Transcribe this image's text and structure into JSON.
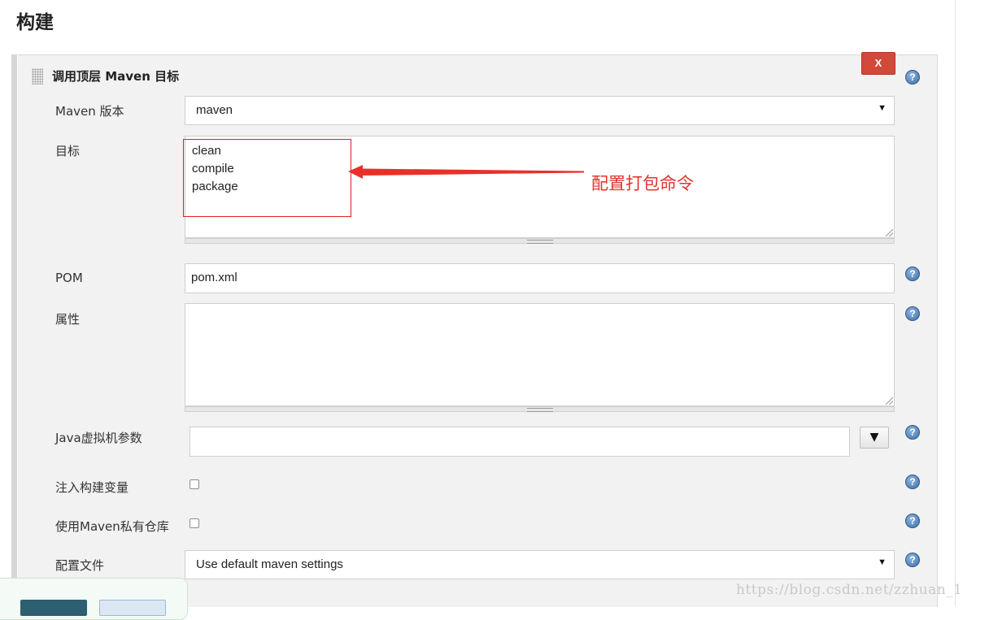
{
  "page": {
    "title": "构建"
  },
  "build_step": {
    "title": "调用顶层 Maven 目标",
    "delete_label": "X",
    "help_glyph": "?",
    "fields": {
      "maven_version": {
        "label": "Maven 版本",
        "value": "maven"
      },
      "goals": {
        "label": "目标",
        "lines": [
          "clean",
          "compile",
          "package"
        ]
      },
      "pom": {
        "label": "POM",
        "value": "pom.xml"
      },
      "properties": {
        "label": "属性",
        "value": ""
      },
      "jvm_options": {
        "label": "Java虚拟机参数",
        "value": "",
        "dropdown_glyph": "▼"
      },
      "inject_build_vars": {
        "label": "注入构建变量",
        "checked": false
      },
      "private_repo": {
        "label": "使用Maven私有仓库",
        "checked": false
      },
      "settings_file": {
        "label": "配置文件",
        "value": "Use default maven settings"
      }
    }
  },
  "annotation": {
    "text": "配置打包命令",
    "color": "#e0342f"
  },
  "watermark": "https://blog.csdn.net/zzhuan_1",
  "colors": {
    "delete": "#d24939",
    "help": "#3a6ea5",
    "primary_button": "#2c5f70"
  }
}
